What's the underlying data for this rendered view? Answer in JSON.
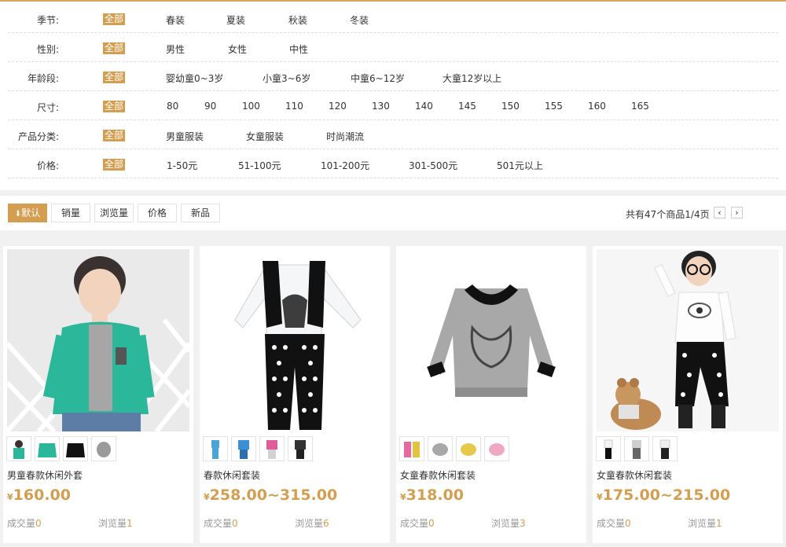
{
  "filters": [
    {
      "label": "季节:",
      "all": "全部",
      "options": [
        "春装",
        "夏装",
        "秋装",
        "冬装"
      ]
    },
    {
      "label": "性别:",
      "all": "全部",
      "options": [
        "男性",
        "女性",
        "中性"
      ]
    },
    {
      "label": "年龄段:",
      "all": "全部",
      "options": [
        "婴幼童0~3岁",
        "小童3~6岁",
        "中童6~12岁",
        "大童12岁以上"
      ]
    },
    {
      "label": "尺寸:",
      "all": "全部",
      "options": [
        "80",
        "90",
        "100",
        "110",
        "120",
        "130",
        "140",
        "145",
        "150",
        "155",
        "160",
        "165"
      ]
    },
    {
      "label": "产品分类:",
      "all": "全部",
      "options": [
        "男童服装",
        "女童服装",
        "时尚潮流"
      ]
    },
    {
      "label": "价格:",
      "all": "全部",
      "options": [
        "1-50元",
        "51-100元",
        "101-200元",
        "301-500元",
        "501元以上"
      ]
    }
  ],
  "sort": {
    "buttons": [
      "默认",
      "销量",
      "浏览量",
      "价格",
      "新品"
    ],
    "active_icon": "down-arrow-icon",
    "page_info": "共有47个商品1/4页",
    "prev_icon": "chevron-left-icon",
    "next_icon": "chevron-right-icon"
  },
  "products": [
    {
      "title": "男童春款休闲外套",
      "currency": "¥",
      "price": "160.00",
      "sold_label": "成交量",
      "sold": "0",
      "views_label": "浏览量",
      "views": "1"
    },
    {
      "title": "春款休闲套装",
      "currency": "¥",
      "price": "258.00~315.00",
      "sold_label": "成交量",
      "sold": "0",
      "views_label": "浏览量",
      "views": "6"
    },
    {
      "title": "女童春款休闲套装",
      "currency": "¥",
      "price": "318.00",
      "sold_label": "成交量",
      "sold": "0",
      "views_label": "浏览量",
      "views": "3"
    },
    {
      "title": "女童春款休闲套装",
      "currency": "¥",
      "price": "175.00~215.00",
      "sold_label": "成交量",
      "sold": "0",
      "views_label": "浏览量",
      "views": "1"
    }
  ],
  "colors": {
    "accent": "#d39e50",
    "top_border": "#d5a95e"
  }
}
